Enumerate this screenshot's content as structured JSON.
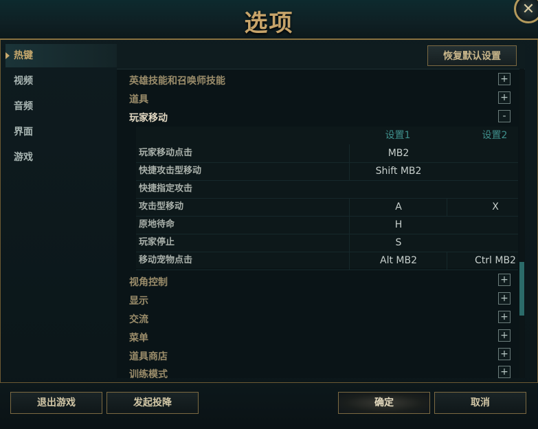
{
  "window": {
    "title": "选项",
    "close_glyph": "✕"
  },
  "sidebar": {
    "items": [
      {
        "label": "热键",
        "active": true
      },
      {
        "label": "视频"
      },
      {
        "label": "音频"
      },
      {
        "label": "界面"
      },
      {
        "label": "游戏"
      }
    ]
  },
  "panel": {
    "reset_label": "恢复默认设置",
    "categories": [
      {
        "label": "英雄技能和召唤师技能",
        "toggle": "+"
      },
      {
        "label": "道具",
        "toggle": "+"
      },
      {
        "label": "玩家移动",
        "toggle": "-"
      },
      {
        "label": "视角控制",
        "toggle": "+"
      },
      {
        "label": "显示",
        "toggle": "+"
      },
      {
        "label": "交流",
        "toggle": "+"
      },
      {
        "label": "菜单",
        "toggle": "+"
      },
      {
        "label": "道具商店",
        "toggle": "+"
      },
      {
        "label": "训练模式",
        "toggle": "+"
      }
    ],
    "table": {
      "col1": "设置1",
      "col2": "设置2",
      "rows": [
        {
          "label": "玩家移动点击",
          "k1": "MB2",
          "k2": ""
        },
        {
          "label": "快捷攻击型移动",
          "k1": "Shift MB2",
          "k2": ""
        },
        {
          "label": "快捷指定攻击",
          "k1": "",
          "k2": ""
        },
        {
          "label": "攻击型移动",
          "k1": "A",
          "k2": "X"
        },
        {
          "label": "原地待命",
          "k1": "H",
          "k2": ""
        },
        {
          "label": "玩家停止",
          "k1": "S",
          "k2": ""
        },
        {
          "label": "移动宠物点击",
          "k1": "Alt MB2",
          "k2": "Ctrl MB2"
        }
      ]
    }
  },
  "footer": {
    "quit_label": "退出游戏",
    "surrender_label": "发起投降",
    "ok_label": "确定",
    "cancel_label": "取消"
  },
  "colors": {
    "gold": "#c7a46a",
    "teal": "#3f8f8c",
    "background": "#0a1417"
  }
}
